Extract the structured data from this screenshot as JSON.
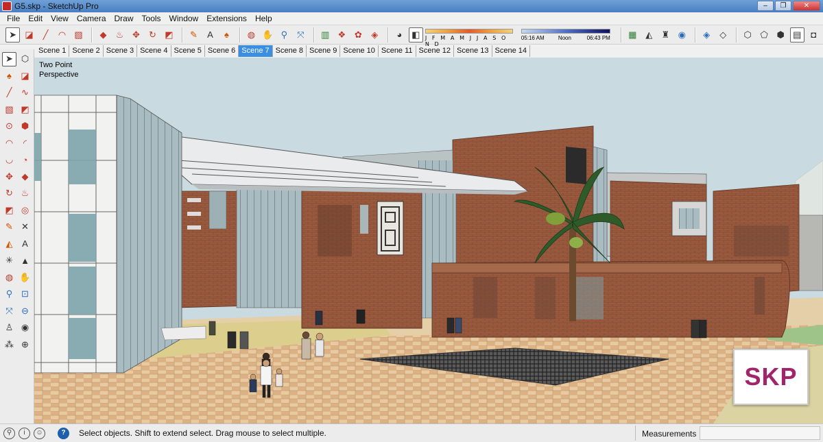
{
  "window": {
    "title": "G5.skp - SketchUp Pro"
  },
  "menu": [
    "File",
    "Edit",
    "View",
    "Camera",
    "Draw",
    "Tools",
    "Window",
    "Extensions",
    "Help"
  ],
  "shadows": {
    "months": "J F M A M J J A S O N D",
    "time_start": "05:16 AM",
    "time_mid": "Noon",
    "time_end": "06:43 PM"
  },
  "scenes": {
    "tabs": [
      "Scene 1",
      "Scene 2",
      "Scene 3",
      "Scene 4",
      "Scene 5",
      "Scene 6",
      "Scene 7",
      "Scene 8",
      "Scene 9",
      "Scene 10",
      "Scene 11",
      "Scene 12",
      "Scene 13",
      "Scene 14"
    ],
    "active": "Scene 7"
  },
  "viewport": {
    "camera_label_line1": "Two Point",
    "camera_label_line2": "Perspective",
    "watermark": "SKP"
  },
  "status": {
    "hint": "Select objects. Shift to extend select. Drag mouse to select multiple.",
    "measurements_label": "Measurements",
    "measurements_value": ""
  },
  "colors": {
    "brick": "#9a5a3e",
    "sky": "#c9dae0",
    "active_tab": "#3b8fe0",
    "logo_text": "#a2246a"
  }
}
